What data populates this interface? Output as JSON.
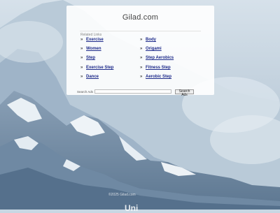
{
  "header": {
    "title": "Gilad.com"
  },
  "related_links": {
    "heading": "Related Links",
    "left": [
      "Exercise",
      "Women",
      "Step",
      "Exercise Step",
      "Dance"
    ],
    "right": [
      "Body",
      "Origami",
      "Step Aerobics",
      "Fitness Step",
      "Aerobic Step"
    ]
  },
  "search": {
    "label": "Search Ads",
    "placeholder": "",
    "button_label": "Search Ads"
  },
  "footer": {
    "small_text": "©2025 Gilad.com",
    "logo_text": "Uni"
  },
  "icons": {
    "link_arrow": "double-chevron-right-icon"
  }
}
